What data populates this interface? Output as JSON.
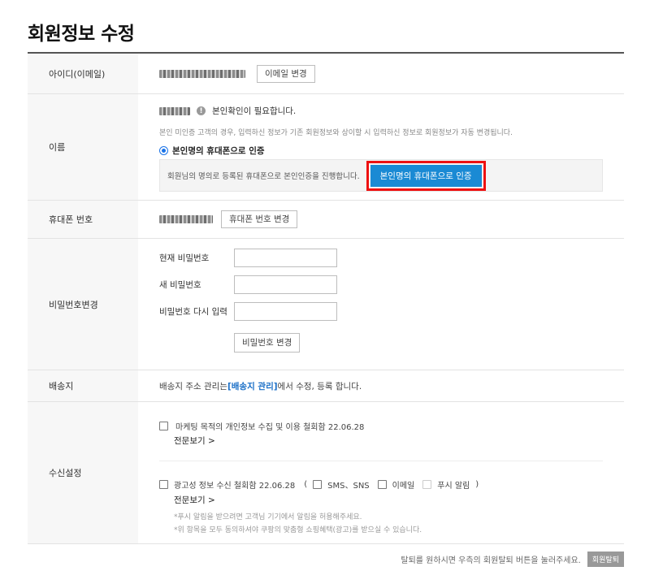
{
  "page": {
    "title": "회원정보 수정"
  },
  "id_row": {
    "label": "아이디(이메일)",
    "change_email_button": "이메일 변경"
  },
  "name_row": {
    "label": "이름",
    "notice": "본인확인이 필요합니다.",
    "description": "본인 미인증 고객의 경우, 입력하신 정보가 기존 회원정보와 상이할 시 입력하신 정보로 회원정보가 자동 변경됩니다.",
    "radio_label": "본인명의 휴대폰으로 인증",
    "auth_text": "회원님의 명의로 등록된 휴대폰으로 본인인증을 진행합니다.",
    "auth_button": "본인명의 휴대폰으로 인증"
  },
  "phone_row": {
    "label": "휴대폰 번호",
    "change_button": "휴대폰 번호 변경"
  },
  "password_row": {
    "label": "비밀번호변경",
    "current_label": "현재 비밀번호",
    "new_label": "새 비밀번호",
    "confirm_label": "비밀번호 다시 입력",
    "change_button": "비밀번호 변경"
  },
  "address_row": {
    "label": "배송지",
    "text_before": "배송지 주소 관리는 ",
    "link": "[배송지 관리]",
    "text_after": "에서 수정, 등록 합니다."
  },
  "receive_row": {
    "label": "수신설정",
    "marketing_label": "마케팅 목적의 개인정보 수집 및 이용 철회함 22.06.28",
    "view_full_1": "전문보기 >",
    "ad_label": "광고성 정보 수신 철회함 22.06.28",
    "paren_open": "(",
    "sms_label": "SMS、SNS",
    "email_label": "이메일",
    "push_label": "푸시 알림",
    "paren_close": ")",
    "view_full_2": "전문보기 >",
    "note_1": "*푸시 알림을 받으려면 고객님 기기에서 알림을 허용해주세요.",
    "note_2": "*위 항목을 모두 동의하셔야 쿠팡의 맞춤형 쇼핑혜택(광고)를 받으실 수 있습니다."
  },
  "footer": {
    "text": "탈퇴를 원하시면 우측의 회원탈퇴 버튼을 눌러주세요.",
    "withdraw_button": "회원탈퇴"
  },
  "colors": {
    "accent": "#1a8ad4",
    "highlight_border": "#ee1111",
    "link": "#1a6fc7"
  }
}
